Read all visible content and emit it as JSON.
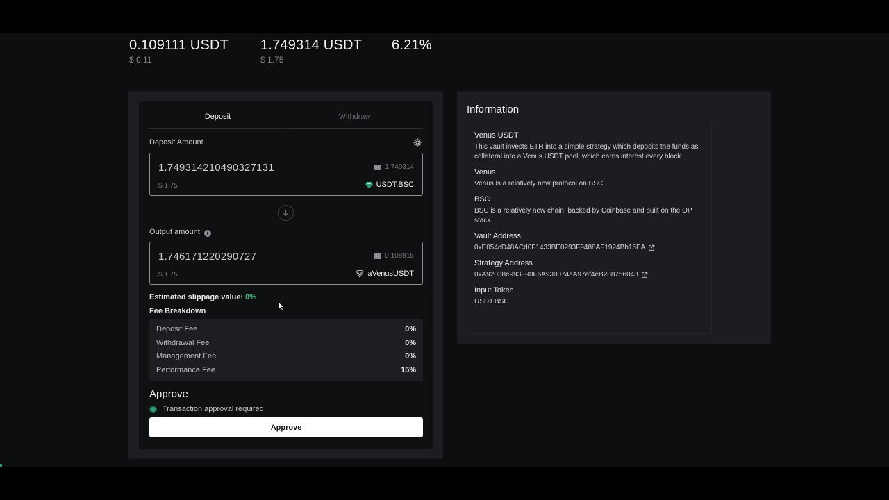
{
  "stats": [
    {
      "value": "0.109111 USDT",
      "usd": "$ 0.11"
    },
    {
      "value": "1.749314 USDT",
      "usd": "$ 1.75"
    },
    {
      "value": "6.21%",
      "usd": ""
    }
  ],
  "tabs": {
    "deposit": "Deposit",
    "withdraw": "Withdraw"
  },
  "deposit": {
    "label": "Deposit Amount",
    "amount": "1.749314210490327131",
    "usd": "$ 1.75",
    "balance": "1.749314",
    "token": "USDT.BSC"
  },
  "output": {
    "label": "Output amount",
    "amount": "1.746171220290727",
    "usd": "$ 1.75",
    "balance": "0.108915",
    "token": "aVenusUSDT"
  },
  "slippage": {
    "label": "Estimated slippage value:",
    "value": "0%"
  },
  "fees": {
    "title": "Fee Breakdown",
    "rows": [
      {
        "name": "Deposit Fee",
        "value": "0%"
      },
      {
        "name": "Withdrawal Fee",
        "value": "0%"
      },
      {
        "name": "Management Fee",
        "value": "0%"
      },
      {
        "name": "Performance Fee",
        "value": "15%"
      }
    ]
  },
  "approve": {
    "title": "Approve",
    "status": "Transaction approval required",
    "button": "Approve"
  },
  "information": {
    "title": "Information",
    "sections": [
      {
        "heading": "Venus USDT",
        "body": "This vault invests ETH into a simple strategy which deposits the funds as collateral into a Venus USDT pool, which earns interest every block."
      },
      {
        "heading": "Venus",
        "body": "Venus is a relatively new protocol on BSC."
      },
      {
        "heading": "BSC",
        "body": "BSC is a relatively new chain, backed by Coinbase and built on the OP stack."
      },
      {
        "heading": "Vault Address",
        "body": "0xE054cD48ACd0F1433BE0293F9488AF1924Bb15EA"
      },
      {
        "heading": "Strategy Address",
        "body": "0xA92038e993F90F6A930074aA97af4eB288756048"
      },
      {
        "heading": "Input Token",
        "body": "USDT.BSC"
      }
    ]
  },
  "colors": {
    "accent_green": "#3fbf7f",
    "status_green": "#2e9c72"
  }
}
